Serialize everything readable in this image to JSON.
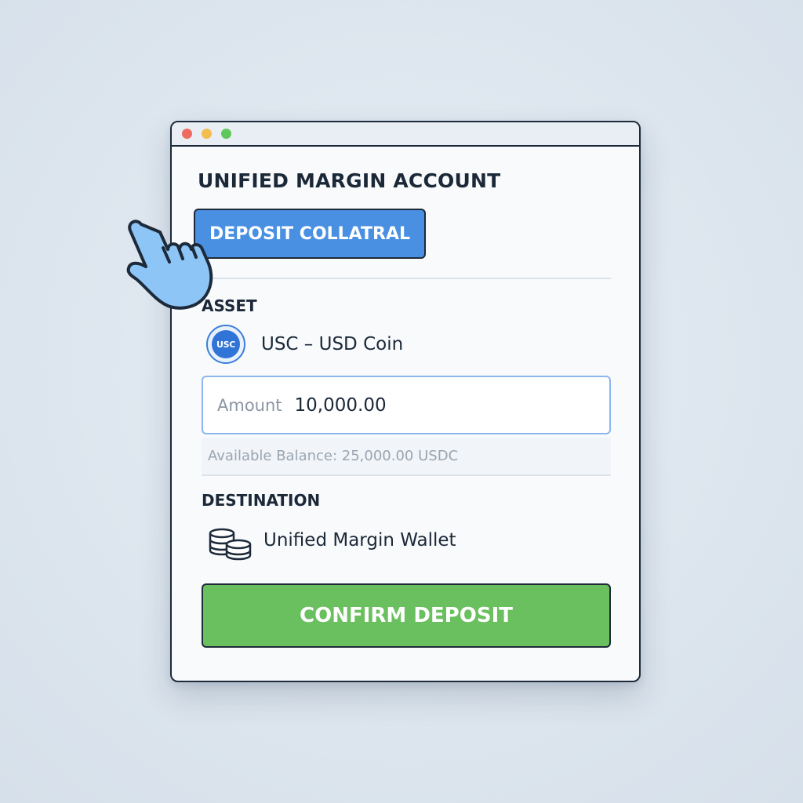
{
  "window": {
    "controls": [
      "close",
      "minimize",
      "maximize"
    ]
  },
  "account": {
    "title": "UNIFIED MARGIN ACCOUNT"
  },
  "actions": {
    "deposit_collateral_label": "DEPOSIT COLLATRAL",
    "confirm_label": "CONFIRM DEPOSIT"
  },
  "asset": {
    "section_label": "ASSET",
    "coin_ticker_badge": "USC",
    "name": "USC – USD Coin"
  },
  "amount": {
    "label": "Amount",
    "value": "10,000.00"
  },
  "balance": {
    "text": "Available Balance: 25,000.00 USDC"
  },
  "destination": {
    "section_label": "DESTINATION",
    "icon": "coins-stack-icon",
    "name": "Unified Margin Wallet"
  },
  "cursor": {
    "icon": "pointing-hand-icon"
  },
  "colors": {
    "accent_blue": "#4a90e2",
    "confirm_green": "#6abf5e",
    "border_dark": "#1c2a3a",
    "input_border": "#8bb7ec"
  }
}
